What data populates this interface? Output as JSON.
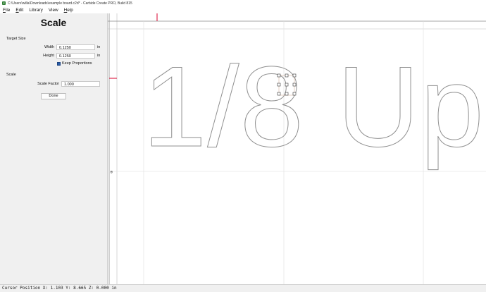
{
  "window": {
    "title": "C:\\Users\\willa\\Downloads\\example board.c2d* - Carbide Create PRO, Build 815"
  },
  "menu": [
    {
      "key": "F",
      "rest": "ile"
    },
    {
      "key": "E",
      "rest": "dit"
    },
    {
      "key": "",
      "rest": "Library"
    },
    {
      "key": "",
      "rest": "View"
    },
    {
      "key": "H",
      "rest": "elp"
    }
  ],
  "panel": {
    "title": "Scale",
    "target_size_label": "Target Size",
    "width_label": "Width",
    "width_value": "0.1250",
    "width_unit": "in",
    "height_label": "Height",
    "height_value": "0.1250",
    "height_unit": "in",
    "keep_proportions_label": "Keep Proportions",
    "keep_proportions_checked": true,
    "scale_label": "Scale",
    "scale_factor_label": "Scale Factor",
    "scale_factor_value": "1.000",
    "done_label": "Done"
  },
  "canvas": {
    "design_text": "1/8 Up",
    "origin_marker": "⊕"
  },
  "status": {
    "cursor_position": "Cursor Position X: 1.103 Y: 8.665 Z: 0.000 in"
  },
  "colors": {
    "accent_checkbox": "#2a5da8",
    "ruler_marker": "#d9002e",
    "selection_handle": "#333333"
  }
}
